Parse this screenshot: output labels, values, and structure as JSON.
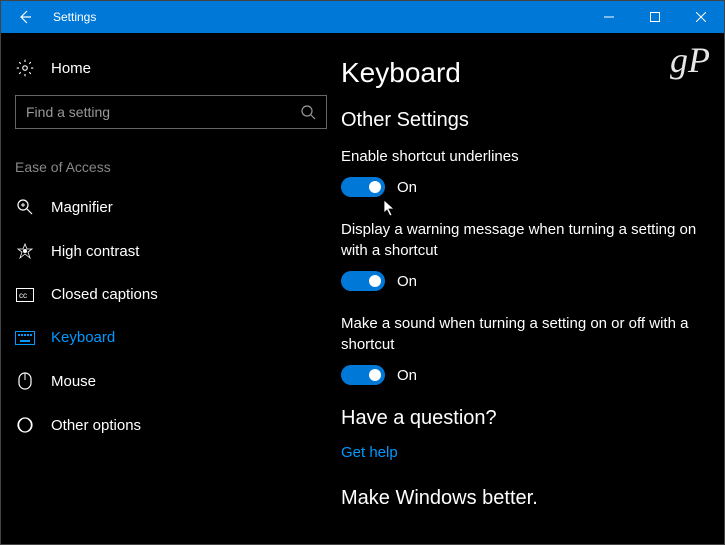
{
  "titlebar": {
    "title": "Settings"
  },
  "sidebar": {
    "home": "Home",
    "search_placeholder": "Find a setting",
    "category": "Ease of Access",
    "items": [
      {
        "label": "Magnifier"
      },
      {
        "label": "High contrast"
      },
      {
        "label": "Closed captions"
      },
      {
        "label": "Keyboard"
      },
      {
        "label": "Mouse"
      },
      {
        "label": "Other options"
      }
    ]
  },
  "main": {
    "title": "Keyboard",
    "section_other": "Other Settings",
    "s1_label": "Enable shortcut underlines",
    "s1_state": "On",
    "s2_label": "Display a warning message when turning a setting on with a shortcut",
    "s2_state": "On",
    "s3_label": "Make a sound when turning a setting on or off with a shortcut",
    "s3_state": "On",
    "question_hdr": "Have a question?",
    "help_link": "Get help",
    "feedback_hdr": "Make Windows better."
  },
  "watermark": "gP"
}
